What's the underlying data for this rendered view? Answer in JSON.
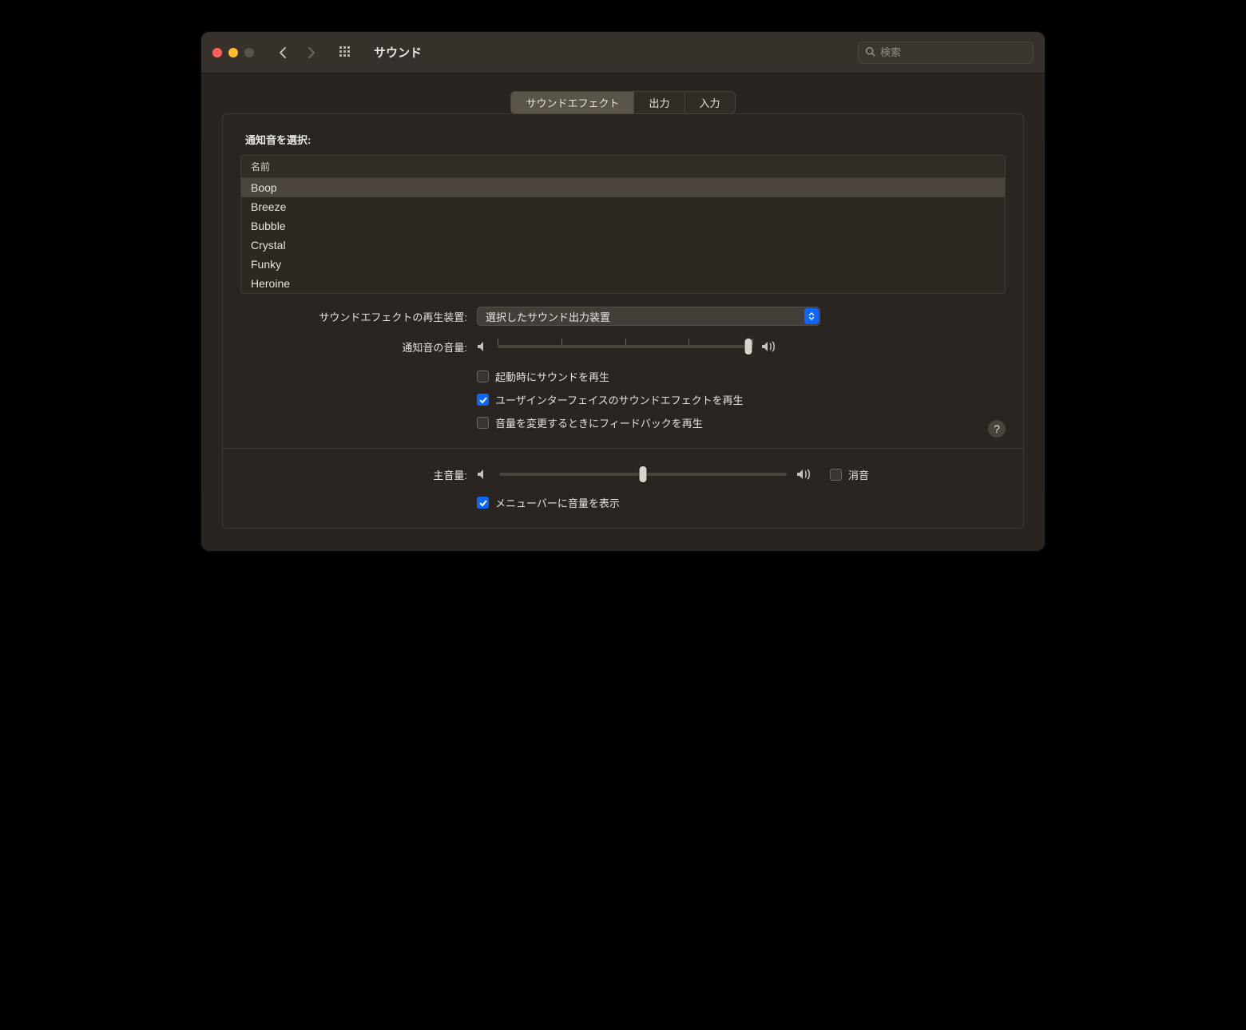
{
  "window": {
    "title": "サウンド",
    "search_placeholder": "検索"
  },
  "tabs": [
    {
      "label": "サウンドエフェクト",
      "active": true
    },
    {
      "label": "出力",
      "active": false
    },
    {
      "label": "入力",
      "active": false
    }
  ],
  "alert_sound": {
    "heading": "通知音を選択:",
    "column_header": "名前",
    "items": [
      {
        "name": "Boop",
        "selected": true
      },
      {
        "name": "Breeze",
        "selected": false
      },
      {
        "name": "Bubble",
        "selected": false
      },
      {
        "name": "Crystal",
        "selected": false
      },
      {
        "name": "Funky",
        "selected": false
      },
      {
        "name": "Heroine",
        "selected": false
      }
    ]
  },
  "play_through": {
    "label": "サウンドエフェクトの再生装置:",
    "value": "選択したサウンド出力装置"
  },
  "alert_volume": {
    "label": "通知音の音量:",
    "value_percent": 98
  },
  "checkboxes": {
    "startup_sound": {
      "label": "起動時にサウンドを再生",
      "checked": false
    },
    "ui_sound": {
      "label": "ユーザインターフェイスのサウンドエフェクトを再生",
      "checked": true
    },
    "volume_feedback": {
      "label": "音量を変更するときにフィードバックを再生",
      "checked": false
    }
  },
  "help_tooltip": "?",
  "main_volume": {
    "label": "主音量:",
    "value_percent": 50,
    "mute_label": "消音",
    "mute_checked": false
  },
  "menu_bar": {
    "label": "メニューバーに音量を表示",
    "checked": true
  }
}
